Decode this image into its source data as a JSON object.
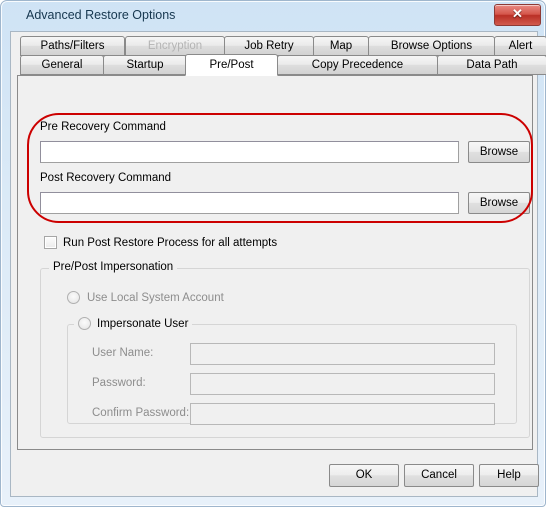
{
  "window": {
    "title": "Advanced Restore Options",
    "close_label": "✕",
    "accent_red": "#cc0000",
    "titlebar_color": "#cfe3f5"
  },
  "tabs": {
    "row1": [
      {
        "label": "Paths/Filters",
        "state": "normal"
      },
      {
        "label": "Encryption",
        "state": "disabled"
      },
      {
        "label": "Job Retry",
        "state": "normal"
      },
      {
        "label": "Map",
        "state": "normal"
      },
      {
        "label": "Browse Options",
        "state": "normal"
      },
      {
        "label": "Alert",
        "state": "normal"
      }
    ],
    "row2": [
      {
        "label": "General",
        "state": "normal"
      },
      {
        "label": "Startup",
        "state": "normal"
      },
      {
        "label": "Pre/Post",
        "state": "active"
      },
      {
        "label": "Copy Precedence",
        "state": "normal"
      },
      {
        "label": "Data Path",
        "state": "normal"
      }
    ]
  },
  "prepost": {
    "pre_label": "Pre Recovery Command",
    "pre_value": "",
    "pre_browse": "Browse",
    "post_label": "Post Recovery Command",
    "post_value": "",
    "post_browse": "Browse",
    "run_post_checkbox": "Run Post Restore Process for all attempts",
    "run_post_checked": false
  },
  "impersonation": {
    "group_title": "Pre/Post Impersonation",
    "local_system_radio": "Use Local System Account",
    "local_system_selected": false,
    "impersonate_radio": "Impersonate User",
    "impersonate_selected": false,
    "fields": [
      {
        "label": "User Name:",
        "value": ""
      },
      {
        "label": "Password:",
        "value": ""
      },
      {
        "label": "Confirm Password:",
        "value": ""
      }
    ]
  },
  "footer": {
    "ok": "OK",
    "cancel": "Cancel",
    "help": "Help"
  }
}
